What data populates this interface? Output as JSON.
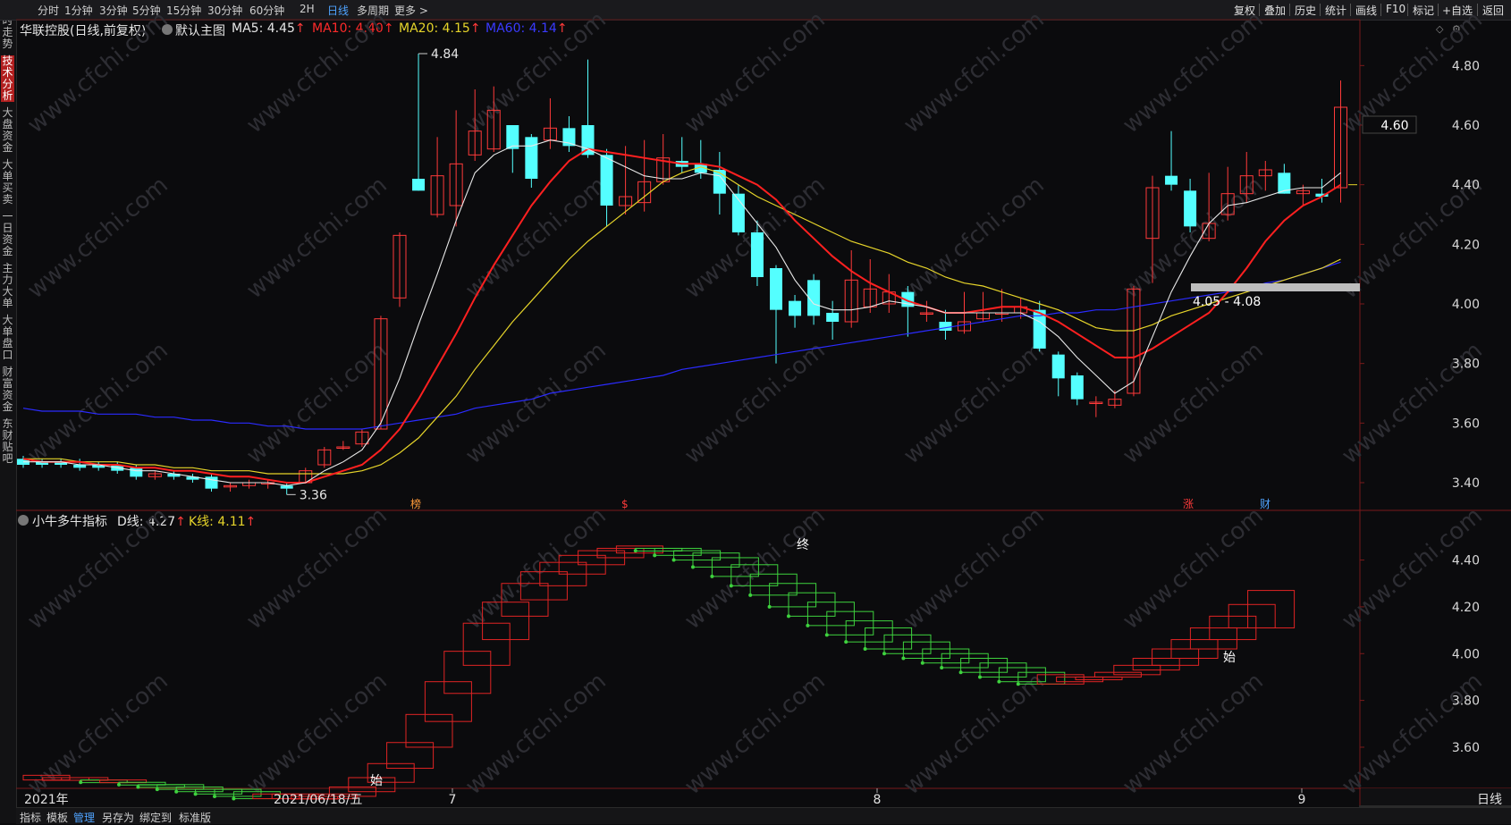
{
  "sidebar": {
    "items": [
      "分时走势",
      "技术分析",
      "大盘资金",
      "大单买卖",
      "一日资金",
      "主力大单",
      "大单盘口",
      "财富资金",
      "东财贴吧"
    ],
    "active_index": 1
  },
  "topbar": {
    "periods": [
      "分时",
      "1分钟",
      "3分钟",
      "5分钟",
      "15分钟",
      "30分钟",
      "60分钟",
      "2H",
      "日线",
      "多周期",
      "更多 >"
    ],
    "active_period": "日线",
    "right_buttons": [
      "复权",
      "叠加",
      "历史",
      "统计",
      "画线",
      "F10",
      "标记",
      "+自选",
      "返回"
    ]
  },
  "main": {
    "stock": "华联控股(日线,前复权)",
    "default": "默认主图",
    "ma5": "MA5: 4.45",
    "ma10": "MA10: 4.40",
    "ma20": "MA20: 4.15",
    "ma60": "MA60: 4.14",
    "arrow": "↑",
    "high_label": "4.84",
    "low_label": "3.36",
    "range_label": "4.05 - 4.08",
    "price_tag": "4.60",
    "markers": [
      "榜",
      "$",
      "涨",
      "财"
    ],
    "yaxis": [
      "4.80",
      "4.60",
      "4.40",
      "4.20",
      "4.00",
      "3.80",
      "3.60",
      "3.40"
    ]
  },
  "indicator": {
    "name": "小牛多牛指标",
    "d_line": "D线: 4.27",
    "k_line": "K线: 4.11",
    "arrow": "↑",
    "labels": [
      "始",
      "终",
      "始"
    ],
    "yaxis": [
      "4.40",
      "4.20",
      "4.00",
      "3.80",
      "3.60"
    ]
  },
  "xaxis": {
    "labels": [
      "2021年",
      "2021/06/18/五",
      "7",
      "8",
      "9"
    ],
    "period": "日线"
  },
  "bottombar": {
    "items": [
      "指标",
      "模板",
      "管理",
      "另存为",
      "绑定到",
      "标准版"
    ],
    "active": "管理"
  },
  "watermark": "www.cfchi.com",
  "colors": {
    "up": "#ff3a3a",
    "down": "#54ffff",
    "ma5": "#e8e8e8",
    "ma10": "#ff2020",
    "ma20": "#e6d42a",
    "ma60": "#2b2bff",
    "bg": "#0b0b0d"
  },
  "chart_data": {
    "type": "candlestick",
    "candles": [
      {
        "o": 3.48,
        "c": 3.46,
        "h": 3.49,
        "l": 3.45
      },
      {
        "o": 3.47,
        "c": 3.46,
        "h": 3.48,
        "l": 3.45
      },
      {
        "o": 3.47,
        "c": 3.46,
        "h": 3.48,
        "l": 3.45
      },
      {
        "o": 3.46,
        "c": 3.45,
        "h": 3.48,
        "l": 3.44
      },
      {
        "o": 3.46,
        "c": 3.45,
        "h": 3.47,
        "l": 3.44
      },
      {
        "o": 3.46,
        "c": 3.44,
        "h": 3.47,
        "l": 3.43
      },
      {
        "o": 3.45,
        "c": 3.42,
        "h": 3.46,
        "l": 3.41
      },
      {
        "o": 3.42,
        "c": 3.43,
        "h": 3.44,
        "l": 3.41
      },
      {
        "o": 3.43,
        "c": 3.42,
        "h": 3.44,
        "l": 3.41
      },
      {
        "o": 3.42,
        "c": 3.41,
        "h": 3.43,
        "l": 3.4
      },
      {
        "o": 3.42,
        "c": 3.38,
        "h": 3.43,
        "l": 3.37
      },
      {
        "o": 3.39,
        "c": 3.39,
        "h": 3.4,
        "l": 3.37
      },
      {
        "o": 3.39,
        "c": 3.4,
        "h": 3.41,
        "l": 3.38
      },
      {
        "o": 3.4,
        "c": 3.4,
        "h": 3.41,
        "l": 3.38
      },
      {
        "o": 3.39,
        "c": 3.38,
        "h": 3.4,
        "l": 3.36
      },
      {
        "o": 3.4,
        "c": 3.44,
        "h": 3.45,
        "l": 3.4
      },
      {
        "o": 3.46,
        "c": 3.51,
        "h": 3.52,
        "l": 3.45
      },
      {
        "o": 3.52,
        "c": 3.52,
        "h": 3.54,
        "l": 3.51
      },
      {
        "o": 3.53,
        "c": 3.57,
        "h": 3.58,
        "l": 3.52
      },
      {
        "o": 3.58,
        "c": 3.95,
        "h": 3.96,
        "l": 3.58
      },
      {
        "o": 4.02,
        "c": 4.23,
        "h": 4.24,
        "l": 3.99
      },
      {
        "o": 4.42,
        "c": 4.38,
        "h": 4.84,
        "l": 4.38
      },
      {
        "o": 4.3,
        "c": 4.43,
        "h": 4.56,
        "l": 4.29
      },
      {
        "o": 4.33,
        "c": 4.47,
        "h": 4.65,
        "l": 4.26
      },
      {
        "o": 4.5,
        "c": 4.58,
        "h": 4.72,
        "l": 4.48
      },
      {
        "o": 4.52,
        "c": 4.65,
        "h": 4.73,
        "l": 4.51
      },
      {
        "o": 4.6,
        "c": 4.52,
        "h": 4.6,
        "l": 4.44
      },
      {
        "o": 4.56,
        "c": 4.42,
        "h": 4.57,
        "l": 4.39
      },
      {
        "o": 4.55,
        "c": 4.59,
        "h": 4.69,
        "l": 4.52
      },
      {
        "o": 4.59,
        "c": 4.53,
        "h": 4.63,
        "l": 4.51
      },
      {
        "o": 4.6,
        "c": 4.5,
        "h": 4.82,
        "l": 4.49
      },
      {
        "o": 4.5,
        "c": 4.33,
        "h": 4.52,
        "l": 4.26
      },
      {
        "o": 4.33,
        "c": 4.36,
        "h": 4.53,
        "l": 4.3
      },
      {
        "o": 4.34,
        "c": 4.41,
        "h": 4.55,
        "l": 4.31
      },
      {
        "o": 4.41,
        "c": 4.49,
        "h": 4.57,
        "l": 4.4
      },
      {
        "o": 4.48,
        "c": 4.46,
        "h": 4.56,
        "l": 4.44
      },
      {
        "o": 4.47,
        "c": 4.44,
        "h": 4.55,
        "l": 4.42
      },
      {
        "o": 4.45,
        "c": 4.37,
        "h": 4.51,
        "l": 4.3
      },
      {
        "o": 4.37,
        "c": 4.24,
        "h": 4.4,
        "l": 4.23
      },
      {
        "o": 4.24,
        "c": 4.09,
        "h": 4.28,
        "l": 4.06
      },
      {
        "o": 4.12,
        "c": 3.98,
        "h": 4.13,
        "l": 3.8
      },
      {
        "o": 4.01,
        "c": 3.96,
        "h": 4.03,
        "l": 3.92
      },
      {
        "o": 4.08,
        "c": 3.96,
        "h": 4.1,
        "l": 3.93
      },
      {
        "o": 3.97,
        "c": 3.94,
        "h": 4.01,
        "l": 3.88
      },
      {
        "o": 3.94,
        "c": 4.08,
        "h": 4.18,
        "l": 3.92
      },
      {
        "o": 3.99,
        "c": 4.05,
        "h": 4.15,
        "l": 3.97
      },
      {
        "o": 4.0,
        "c": 4.04,
        "h": 4.1,
        "l": 3.97
      },
      {
        "o": 4.04,
        "c": 3.99,
        "h": 4.06,
        "l": 3.89
      },
      {
        "o": 3.97,
        "c": 3.97,
        "h": 4.01,
        "l": 3.94
      },
      {
        "o": 3.94,
        "c": 3.91,
        "h": 3.98,
        "l": 3.88
      },
      {
        "o": 3.91,
        "c": 3.94,
        "h": 4.04,
        "l": 3.9
      },
      {
        "o": 3.95,
        "c": 3.97,
        "h": 4.04,
        "l": 3.94
      },
      {
        "o": 3.97,
        "c": 3.97,
        "h": 4.05,
        "l": 3.94
      },
      {
        "o": 3.97,
        "c": 3.99,
        "h": 4.02,
        "l": 3.95
      },
      {
        "o": 3.98,
        "c": 3.85,
        "h": 4.01,
        "l": 3.84
      },
      {
        "o": 3.83,
        "c": 3.75,
        "h": 3.84,
        "l": 3.69
      },
      {
        "o": 3.76,
        "c": 3.68,
        "h": 3.77,
        "l": 3.66
      },
      {
        "o": 3.67,
        "c": 3.67,
        "h": 3.69,
        "l": 3.62
      },
      {
        "o": 3.66,
        "c": 3.68,
        "h": 3.71,
        "l": 3.65
      },
      {
        "o": 3.7,
        "c": 4.05,
        "h": 4.06,
        "l": 3.69
      },
      {
        "o": 4.22,
        "c": 4.39,
        "h": 4.43,
        "l": 4.07
      },
      {
        "o": 4.43,
        "c": 4.4,
        "h": 4.58,
        "l": 4.38
      },
      {
        "o": 4.38,
        "c": 4.26,
        "h": 4.42,
        "l": 4.24
      },
      {
        "o": 4.22,
        "c": 4.27,
        "h": 4.44,
        "l": 4.21
      },
      {
        "o": 4.3,
        "c": 4.37,
        "h": 4.46,
        "l": 4.28
      },
      {
        "o": 4.37,
        "c": 4.43,
        "h": 4.51,
        "l": 4.34
      },
      {
        "o": 4.43,
        "c": 4.45,
        "h": 4.48,
        "l": 4.38
      },
      {
        "o": 4.44,
        "c": 4.37,
        "h": 4.47,
        "l": 4.37
      },
      {
        "o": 4.37,
        "c": 4.38,
        "h": 4.4,
        "l": 4.33
      },
      {
        "o": 4.37,
        "c": 4.36,
        "h": 4.42,
        "l": 4.34
      },
      {
        "o": 4.39,
        "c": 4.66,
        "h": 4.75,
        "l": 4.34
      }
    ],
    "ma5": [
      3.47,
      3.47,
      3.47,
      3.46,
      3.46,
      3.45,
      3.44,
      3.44,
      3.43,
      3.42,
      3.41,
      3.4,
      3.4,
      3.4,
      3.39,
      3.4,
      3.44,
      3.47,
      3.51,
      3.6,
      3.75,
      3.93,
      4.1,
      4.28,
      4.44,
      4.5,
      4.53,
      4.53,
      4.55,
      4.54,
      4.52,
      4.49,
      4.46,
      4.43,
      4.42,
      4.42,
      4.44,
      4.43,
      4.35,
      4.27,
      4.19,
      4.08,
      4.0,
      3.98,
      3.98,
      3.99,
      4.01,
      4.0,
      3.99,
      3.97,
      3.97,
      3.97,
      3.97,
      3.97,
      3.94,
      3.89,
      3.82,
      3.76,
      3.7,
      3.74,
      3.89,
      4.04,
      4.16,
      4.27,
      4.33,
      4.34,
      4.36,
      4.38,
      4.39,
      4.39,
      4.44
    ],
    "ma10": [
      3.48,
      3.47,
      3.47,
      3.47,
      3.46,
      3.46,
      3.45,
      3.45,
      3.44,
      3.44,
      3.43,
      3.42,
      3.42,
      3.41,
      3.4,
      3.4,
      3.42,
      3.44,
      3.46,
      3.51,
      3.58,
      3.68,
      3.79,
      3.9,
      4.02,
      4.13,
      4.23,
      4.33,
      4.41,
      4.48,
      4.52,
      4.51,
      4.5,
      4.49,
      4.48,
      4.47,
      4.47,
      4.46,
      4.43,
      4.4,
      4.35,
      4.28,
      4.22,
      4.16,
      4.11,
      4.07,
      4.04,
      4.01,
      3.99,
      3.97,
      3.97,
      3.98,
      3.99,
      3.99,
      3.97,
      3.94,
      3.9,
      3.86,
      3.82,
      3.82,
      3.85,
      3.89,
      3.93,
      3.97,
      4.04,
      4.12,
      4.21,
      4.28,
      4.33,
      4.36,
      4.4
    ],
    "ma20": [
      3.48,
      3.48,
      3.48,
      3.47,
      3.47,
      3.47,
      3.46,
      3.46,
      3.45,
      3.45,
      3.44,
      3.44,
      3.44,
      3.43,
      3.43,
      3.43,
      3.43,
      3.43,
      3.44,
      3.46,
      3.5,
      3.55,
      3.62,
      3.69,
      3.78,
      3.86,
      3.94,
      4.01,
      4.08,
      4.15,
      4.21,
      4.26,
      4.31,
      4.36,
      4.41,
      4.44,
      4.46,
      4.44,
      4.4,
      4.36,
      4.33,
      4.3,
      4.27,
      4.24,
      4.21,
      4.19,
      4.17,
      4.14,
      4.12,
      4.09,
      4.07,
      4.06,
      4.04,
      4.02,
      4.0,
      3.98,
      3.95,
      3.92,
      3.91,
      3.91,
      3.93,
      3.96,
      3.98,
      4.0,
      4.02,
      4.04,
      4.06,
      4.08,
      4.1,
      4.12,
      4.15
    ],
    "ma60": [
      3.65,
      3.64,
      3.64,
      3.64,
      3.63,
      3.63,
      3.63,
      3.62,
      3.62,
      3.61,
      3.61,
      3.6,
      3.6,
      3.59,
      3.59,
      3.58,
      3.58,
      3.58,
      3.58,
      3.59,
      3.6,
      3.61,
      3.62,
      3.63,
      3.65,
      3.66,
      3.67,
      3.68,
      3.7,
      3.71,
      3.72,
      3.73,
      3.74,
      3.75,
      3.76,
      3.78,
      3.79,
      3.8,
      3.81,
      3.82,
      3.83,
      3.84,
      3.85,
      3.86,
      3.87,
      3.88,
      3.89,
      3.9,
      3.91,
      3.92,
      3.93,
      3.94,
      3.95,
      3.96,
      3.96,
      3.97,
      3.97,
      3.98,
      3.98,
      3.99,
      4.0,
      4.01,
      4.02,
      4.03,
      4.04,
      4.05,
      4.07,
      4.08,
      4.1,
      4.12,
      4.14
    ],
    "indicator_boxes": [
      {
        "d": 3.46,
        "k": 3.48
      },
      {
        "d": 3.46,
        "k": 3.47
      },
      {
        "d": 3.46,
        "k": 3.47
      },
      {
        "d": 3.45,
        "k": 3.46
      },
      {
        "d": 3.45,
        "k": 3.46
      },
      {
        "d": 3.44,
        "k": 3.45
      },
      {
        "d": 3.43,
        "k": 3.44
      },
      {
        "d": 3.42,
        "k": 3.44
      },
      {
        "d": 3.41,
        "k": 3.43
      },
      {
        "d": 3.4,
        "k": 3.42
      },
      {
        "d": 3.39,
        "k": 3.42
      },
      {
        "d": 3.38,
        "k": 3.41
      },
      {
        "d": 3.38,
        "k": 3.4
      },
      {
        "d": 3.38,
        "k": 3.4
      },
      {
        "d": 3.38,
        "k": 3.39
      },
      {
        "d": 3.4,
        "k": 3.38
      },
      {
        "d": 3.43,
        "k": 3.39
      },
      {
        "d": 3.47,
        "k": 3.41
      },
      {
        "d": 3.53,
        "k": 3.45
      },
      {
        "d": 3.62,
        "k": 3.51
      },
      {
        "d": 3.74,
        "k": 3.6
      },
      {
        "d": 3.88,
        "k": 3.71
      },
      {
        "d": 4.01,
        "k": 3.83
      },
      {
        "d": 4.13,
        "k": 3.95
      },
      {
        "d": 4.22,
        "k": 4.06
      },
      {
        "d": 4.3,
        "k": 4.16
      },
      {
        "d": 4.35,
        "k": 4.23
      },
      {
        "d": 4.39,
        "k": 4.29
      },
      {
        "d": 4.42,
        "k": 4.34
      },
      {
        "d": 4.44,
        "k": 4.38
      },
      {
        "d": 4.45,
        "k": 4.41
      },
      {
        "d": 4.46,
        "k": 4.43
      },
      {
        "d": 4.44,
        "k": 4.45
      },
      {
        "d": 4.42,
        "k": 4.45
      },
      {
        "d": 4.4,
        "k": 4.44
      },
      {
        "d": 4.37,
        "k": 4.43
      },
      {
        "d": 4.33,
        "k": 4.41
      },
      {
        "d": 4.29,
        "k": 4.38
      },
      {
        "d": 4.25,
        "k": 4.34
      },
      {
        "d": 4.2,
        "k": 4.3
      },
      {
        "d": 4.16,
        "k": 4.26
      },
      {
        "d": 4.12,
        "k": 4.22
      },
      {
        "d": 4.08,
        "k": 4.18
      },
      {
        "d": 4.05,
        "k": 4.14
      },
      {
        "d": 4.02,
        "k": 4.11
      },
      {
        "d": 4.0,
        "k": 4.08
      },
      {
        "d": 3.98,
        "k": 4.05
      },
      {
        "d": 3.96,
        "k": 4.02
      },
      {
        "d": 3.94,
        "k": 4.0
      },
      {
        "d": 3.92,
        "k": 3.98
      },
      {
        "d": 3.9,
        "k": 3.96
      },
      {
        "d": 3.88,
        "k": 3.94
      },
      {
        "d": 3.87,
        "k": 3.92
      },
      {
        "d": 3.87,
        "k": 3.91
      },
      {
        "d": 3.88,
        "k": 3.9
      },
      {
        "d": 3.9,
        "k": 3.89
      },
      {
        "d": 3.92,
        "k": 3.9
      },
      {
        "d": 3.95,
        "k": 3.91
      },
      {
        "d": 3.98,
        "k": 3.93
      },
      {
        "d": 4.02,
        "k": 3.95
      },
      {
        "d": 4.06,
        "k": 3.98
      },
      {
        "d": 4.11,
        "k": 4.02
      },
      {
        "d": 4.16,
        "k": 4.06
      },
      {
        "d": 4.21,
        "k": 4.11
      },
      {
        "d": 4.27,
        "k": 4.11
      }
    ]
  }
}
